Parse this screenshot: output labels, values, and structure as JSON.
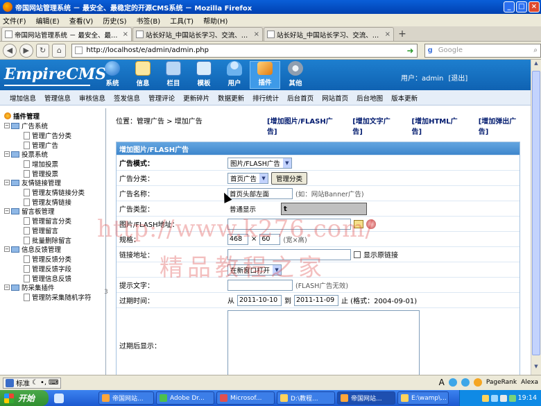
{
  "window": {
    "title": "帝国网站管理系统 － 最安全、最稳定的开源CMS系统 － Mozilla Firefox"
  },
  "menubar": [
    "文件(F)",
    "编辑(E)",
    "查看(V)",
    "历史(S)",
    "书签(B)",
    "工具(T)",
    "帮助(H)"
  ],
  "tabs": [
    {
      "label": "帝国网站管理系统 － 最安全、最稳...",
      "active": true
    },
    {
      "label": "站长好站_中国站长学习、交流、资源...",
      "active": false
    },
    {
      "label": "站长好站_中国站长学习、交流、资源...",
      "active": false
    }
  ],
  "navbar": {
    "url": "http://localhost/e/admin/admin.php",
    "search_placeholder": "Google"
  },
  "cms": {
    "logo": "EmpireCMS",
    "nav": [
      {
        "label": "系统",
        "icon": "globe-icon",
        "color": "#3a8be0"
      },
      {
        "label": "信息",
        "icon": "notepad-icon",
        "color": "#f3c24a"
      },
      {
        "label": "栏目",
        "icon": "folder-icon",
        "color": "#6aa3e0"
      },
      {
        "label": "模板",
        "icon": "template-icon",
        "color": "#5aa0d6"
      },
      {
        "label": "用户",
        "icon": "user-icon",
        "color": "#66b5ea"
      },
      {
        "label": "插件",
        "icon": "plugin-icon",
        "color": "#f0a040"
      },
      {
        "label": "其他",
        "icon": "gear-icon",
        "color": "#9aa9ba"
      }
    ],
    "user_text": "用户：admin",
    "logout": "[退出]"
  },
  "subnav": [
    "增加信息",
    "管理信息",
    "审核信息",
    "签发信息",
    "管理评论",
    "更新碎片",
    "数据更新",
    "排行统计",
    "后台首页",
    "网站首页",
    "后台地图",
    "版本更新"
  ],
  "sidebar": {
    "root": "插件管理",
    "groups": [
      {
        "label": "广告系统",
        "items": [
          "管理广告分类",
          "管理广告"
        ]
      },
      {
        "label": "投票系统",
        "items": [
          "增加投票",
          "管理投票"
        ]
      },
      {
        "label": "友情链接管理",
        "items": [
          "管理友情链接分类",
          "管理友情链接"
        ]
      },
      {
        "label": "留言板管理",
        "items": [
          "管理留言分类",
          "管理留言",
          "批量删除留言"
        ]
      },
      {
        "label": "信息反馈管理",
        "items": [
          "管理反馈分类",
          "管理反馈字段",
          "管理信息反馈"
        ]
      },
      {
        "label": "防采集插件",
        "items": [
          "管理防采集随机字符"
        ]
      }
    ]
  },
  "breadcrumb": {
    "prefix": "位置：",
    "link": "管理广告",
    "sep": " > ",
    "current": "增加广告"
  },
  "quick_links": [
    "[增加图片/FLASH广告]",
    "[增加文字广告]",
    "[增加HTML广告]",
    "[增加弹出广告]"
  ],
  "form": {
    "header": "增加图片/FLASH广告",
    "mode_label": "广告模式：",
    "mode_value": "图片/FLASH广告",
    "category_label": "广告分类：",
    "category_value": "首页广告",
    "category_button": "管理分类",
    "name_label": "广告名称：",
    "name_value": "首页头部左面",
    "name_hint": "(如：网站Banner广告)",
    "type_label": "广告类型：",
    "type_value": "普通显示",
    "popup_text": "t",
    "url_label": "图片/FLASH地址：",
    "size_label": "规格：",
    "width_value": "468",
    "times": "×",
    "height_value": "60",
    "size_hint": "(宽×高)",
    "link_label": "链接地址：",
    "show_original_label": "显示原链接",
    "target_value": "在新窗口打开",
    "tip_label": "提示文字：",
    "tip_hint": "(FLASH广告无效)",
    "expire_label": "过期时间：",
    "from": "从",
    "start_date": "2011-10-10",
    "to": "到",
    "end_date": "2011-11-09",
    "format_hint": "止 (格式：2004-09-01)",
    "after_expire_label": "过期后显示："
  },
  "watermark": {
    "line1": "http://www.k276.com/",
    "line2": "精品教程之家"
  },
  "statusbar": {
    "ime": "标准",
    "pagerank": "PageRank",
    "alexa": "Alexa"
  },
  "taskbar": {
    "start": "开始",
    "items": [
      "帝国网站...",
      "Adobe Dr...",
      "Microsof...",
      "D:\\教程...",
      "帝国网站...",
      "E:\\wamp\\..."
    ],
    "clock": "19:14"
  }
}
